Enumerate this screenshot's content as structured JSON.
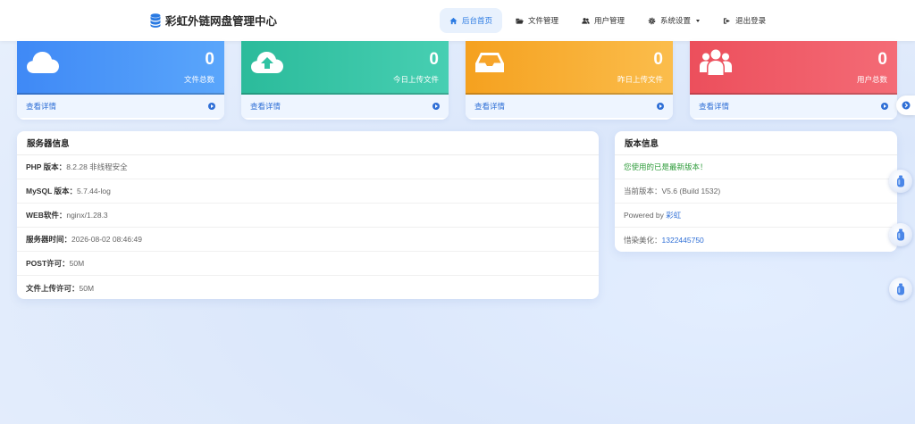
{
  "brand": {
    "title": "彩虹外链网盘管理中心",
    "icon": "database-icon"
  },
  "nav": [
    {
      "label": "后台首页",
      "icon": "home-icon",
      "active": true
    },
    {
      "label": "文件管理",
      "icon": "folder-open-icon",
      "active": false
    },
    {
      "label": "用户管理",
      "icon": "users-icon",
      "active": false
    },
    {
      "label": "系统设置",
      "icon": "gear-icon",
      "active": false,
      "dropdown": true
    },
    {
      "label": "退出登录",
      "icon": "sign-out-icon",
      "active": false
    }
  ],
  "stats": [
    {
      "value": "0",
      "label": "文件总数",
      "link": "查看详情",
      "icon": "cloud-icon",
      "color": "#3d8ef5"
    },
    {
      "value": "0",
      "label": "今日上传文件",
      "link": "查看详情",
      "icon": "cloud-upload-icon",
      "color": "#2fc3a3"
    },
    {
      "value": "0",
      "label": "昨日上传文件",
      "link": "查看详情",
      "icon": "inbox-icon",
      "color": "#f7a52a"
    },
    {
      "value": "0",
      "label": "用户总数",
      "link": "查看详情",
      "icon": "users-icon",
      "color": "#ee5562"
    }
  ],
  "server": {
    "title": "服务器信息",
    "rows": [
      {
        "key": "PHP 版本：",
        "value": "8.2.28 非线程安全"
      },
      {
        "key": "MySQL 版本：",
        "value": "5.7.44-log"
      },
      {
        "key": "WEB软件：",
        "value": "nginx/1.28.3"
      },
      {
        "key": "服务器时间：",
        "value": "2026-08-02 08:46:49"
      },
      {
        "key": "POST许可：",
        "value": "50M"
      },
      {
        "key": "文件上传许可：",
        "value": "50M"
      }
    ]
  },
  "version": {
    "title": "版本信息",
    "latest_msg": "您使用的已是最新版本！",
    "current_label": "当前版本：",
    "current_value": "V5.6 (Build 1532)",
    "powered_label": "Powered by ",
    "powered_link": "彩虹",
    "theme_label": "惜染美化：",
    "theme_link": "1322445750"
  },
  "colors": {
    "accent": "#2f6fd6",
    "nav_active_bg": "#e8f1fd",
    "success": "#2e9b3a"
  }
}
